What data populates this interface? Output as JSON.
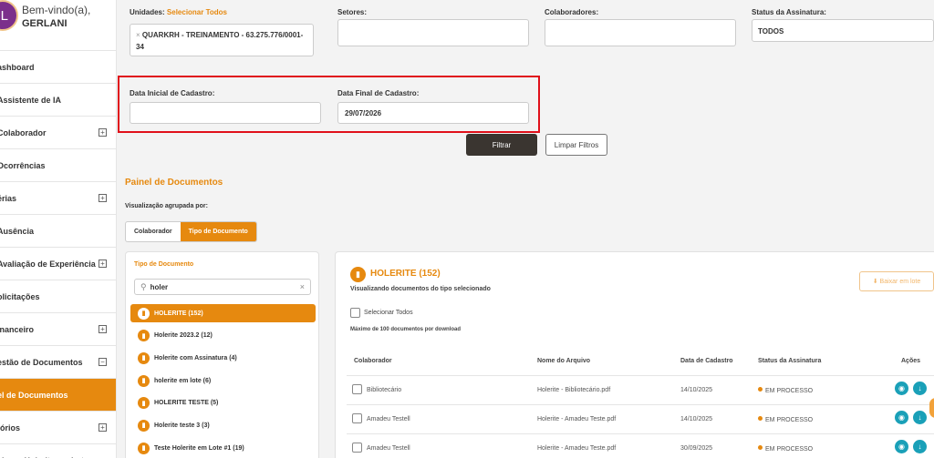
{
  "sidebar": {
    "avatar_initial": "L",
    "welcome": "Bem-vindo(a),",
    "username": "GERLANI",
    "items": [
      {
        "label": "ashboard",
        "toggle": ""
      },
      {
        "label": "Assistente de IA",
        "toggle": ""
      },
      {
        "label": "Colaborador",
        "toggle": "+"
      },
      {
        "label": "Ocorrências",
        "toggle": ""
      },
      {
        "label": "érias",
        "toggle": "+"
      },
      {
        "label": "Ausência",
        "toggle": ""
      },
      {
        "label": "Avaliação de Experiência",
        "toggle": "+"
      },
      {
        "label": "olicitações",
        "toggle": ""
      },
      {
        "label": "inanceiro",
        "toggle": "+"
      },
      {
        "label": "estão de Documentos",
        "toggle": "−"
      },
      {
        "label": "el de Documentos",
        "toggle": ""
      },
      {
        "label": "tórios",
        "toggle": "+"
      },
      {
        "label": "cionar Holerite em Lote",
        "toggle": ""
      }
    ]
  },
  "filters": {
    "units_label": "Unidades: ",
    "units_select_all": "Selecionar Todos",
    "unit_chip_remove": "×",
    "unit_chip": "QUARKRH - TREINAMENTO - 63.275.776/0001-34",
    "sectors_label": "Setores:",
    "collaborators_label": "Colaboradores:",
    "status_label": "Status da Assinatura:",
    "status_value": "TODOS",
    "start_date_label": "Data Inicial de Cadastro:",
    "start_date_value": "",
    "end_date_label": "Data Final de Cadastro:",
    "end_date_value": "29/07/2026",
    "filter_button": "Filtrar",
    "clear_button": "Limpar Filtros"
  },
  "panel": {
    "title": "Painel de Documentos",
    "grouped_by_label": "Visualização agrupada por:",
    "group_options": [
      "Colaborador",
      "Tipo de Documento"
    ],
    "group_selected": "Tipo de Documento"
  },
  "doc_types": {
    "title": "Tipo de Documento",
    "search_value": "holer",
    "items": [
      {
        "label": "HOLERITE (152)",
        "selected": true
      },
      {
        "label": "Holerite 2023.2 (12)",
        "selected": false
      },
      {
        "label": "Holerite com Assinatura (4)",
        "selected": false
      },
      {
        "label": "holerite em lote (6)",
        "selected": false
      },
      {
        "label": "HOLERITE TESTE (5)",
        "selected": false
      },
      {
        "label": "Holerite teste 3 (3)",
        "selected": false
      },
      {
        "label": "Teste Holerite em Lote #1 (19)",
        "selected": false
      }
    ]
  },
  "documents": {
    "title": "HOLERITE (152)",
    "subtitle": "Visualizando documentos do tipo selecionado",
    "batch_download": "⬇ Baixar em lote",
    "select_all": "Selecionar Todos",
    "max_note": "Máximo de 100 documentos por download",
    "columns": [
      "Colaborador",
      "Nome do Arquivo",
      "Data de Cadastro",
      "Status da Assinatura",
      "Ações"
    ],
    "rows": [
      {
        "collaborator": "Bibliotecário",
        "file": "Holerite - Bibliotecário.pdf",
        "date": "14/10/2025",
        "status": "EM PROCESSO"
      },
      {
        "collaborator": "Amadeu Testell",
        "file": "Holerite - Amadeu Teste.pdf",
        "date": "14/10/2025",
        "status": "EM PROCESSO"
      },
      {
        "collaborator": "Amadeu Testell",
        "file": "Holerite - Amadeu Teste.pdf",
        "date": "30/09/2025",
        "status": "EM PROCESSO"
      }
    ]
  },
  "colors": {
    "accent": "#e6890f",
    "dark_button": "#3a3530",
    "highlight": "#e0101a",
    "action": "#1aa0b8"
  },
  "icons": [
    "file-icon",
    "search-icon",
    "clear-icon",
    "view-icon",
    "download-icon",
    "expand-icon",
    "collapse-icon"
  ]
}
